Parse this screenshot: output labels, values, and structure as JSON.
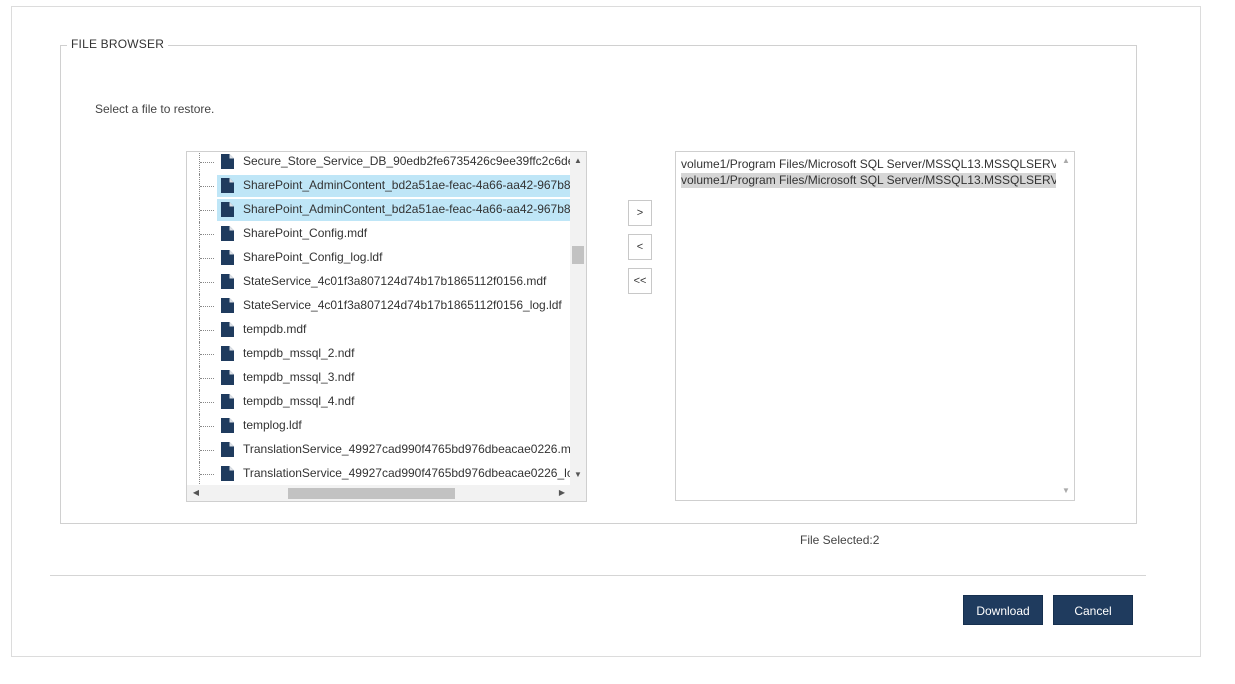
{
  "panel": {
    "legend": "FILE BROWSER",
    "instruction": "Select a file to restore."
  },
  "tree": {
    "items": [
      {
        "label": "Secure_Store_Service_DB_90edb2fe6735426c9ee39ffc2c6de",
        "selected": false,
        "icon": "file-icon"
      },
      {
        "label": "SharePoint_AdminContent_bd2a51ae-feac-4a66-aa42-967b8",
        "selected": true,
        "icon": "file-icon"
      },
      {
        "label": "SharePoint_AdminContent_bd2a51ae-feac-4a66-aa42-967b8",
        "selected": true,
        "icon": "file-icon"
      },
      {
        "label": "SharePoint_Config.mdf",
        "selected": false,
        "icon": "file-icon"
      },
      {
        "label": "SharePoint_Config_log.ldf",
        "selected": false,
        "icon": "file-icon"
      },
      {
        "label": "StateService_4c01f3a807124d74b17b1865112f0156.mdf",
        "selected": false,
        "icon": "file-icon"
      },
      {
        "label": "StateService_4c01f3a807124d74b17b1865112f0156_log.ldf",
        "selected": false,
        "icon": "file-icon"
      },
      {
        "label": "tempdb.mdf",
        "selected": false,
        "icon": "file-icon"
      },
      {
        "label": "tempdb_mssql_2.ndf",
        "selected": false,
        "icon": "file-icon"
      },
      {
        "label": "tempdb_mssql_3.ndf",
        "selected": false,
        "icon": "file-icon"
      },
      {
        "label": "tempdb_mssql_4.ndf",
        "selected": false,
        "icon": "file-icon"
      },
      {
        "label": "templog.ldf",
        "selected": false,
        "icon": "file-icon"
      },
      {
        "label": "TranslationService_49927cad990f4765bd976dbeacae0226.m",
        "selected": false,
        "icon": "file-icon"
      },
      {
        "label": "TranslationService_49927cad990f4765bd976dbeacae0226_lc",
        "selected": false,
        "icon": "file-icon"
      }
    ],
    "selection_color": "#bfe6f7"
  },
  "move_buttons": {
    "add": ">",
    "remove": "<",
    "remove_all": "<<"
  },
  "selected_files": {
    "items": [
      {
        "label": "volume1/Program Files/Microsoft SQL Server/MSSQL13.MSSQLSERV",
        "highlighted": false
      },
      {
        "label": "volume1/Program Files/Microsoft SQL Server/MSSQL13.MSSQLSERV",
        "highlighted": true
      }
    ]
  },
  "status": {
    "file_selected": "File Selected:2"
  },
  "actions": {
    "download": "Download",
    "cancel": "Cancel",
    "button_color": "#1f3b5e"
  }
}
